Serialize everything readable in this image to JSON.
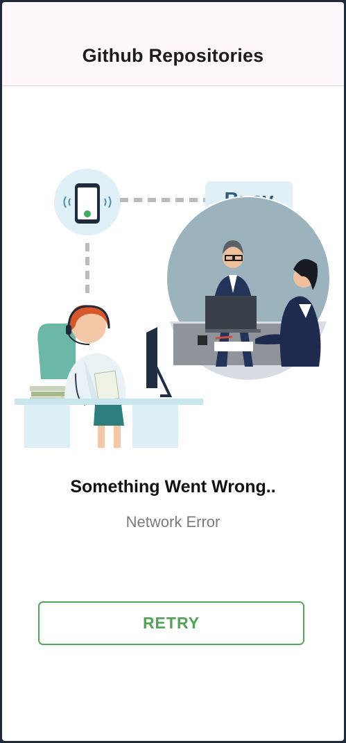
{
  "appbar": {
    "title": "Github Repositories"
  },
  "illustration": {
    "badge": "Busy"
  },
  "error": {
    "title": "Something Went Wrong..",
    "message": "Network Error",
    "retry_label": "RETRY"
  },
  "colors": {
    "accent": "#4ea356",
    "appbar_bg": "#fdf7fb",
    "badge_bg": "#dff1f6",
    "badge_text": "#2d5b7c"
  }
}
